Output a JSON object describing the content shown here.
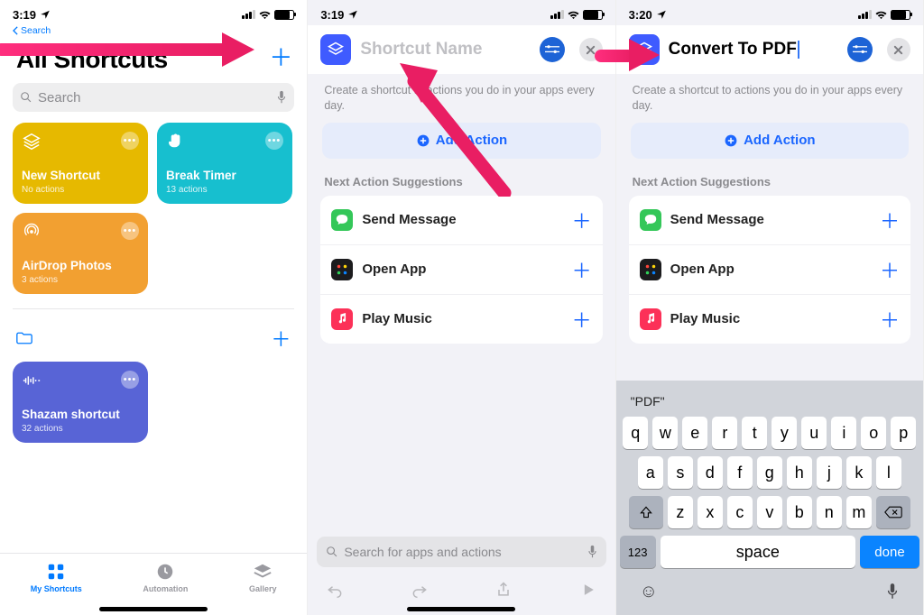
{
  "status": {
    "time1": "3:19",
    "time2": "3:19",
    "time3": "3:20",
    "back": "Search"
  },
  "p1": {
    "title": "All Shortcuts",
    "search_placeholder": "Search",
    "plus": "＋",
    "cards": [
      {
        "name": "New Shortcut",
        "sub": "No actions",
        "color": "#e6b900"
      },
      {
        "name": "Break Timer",
        "sub": "13 actions",
        "color": "#17bfcf"
      },
      {
        "name": "AirDrop Photos",
        "sub": "3 actions",
        "color": "#f2a031"
      },
      {
        "name": "Shazam shortcut",
        "sub": "32 actions",
        "color": "#5864d6"
      }
    ],
    "tabs": [
      "My Shortcuts",
      "Automation",
      "Gallery"
    ]
  },
  "editor": {
    "placeholder": "Shortcut Name",
    "title3": "Convert To PDF",
    "desc": "Create a shortcut to actions you do in your apps every day.",
    "add_action": "Add Action",
    "sugg_header": "Next Action Suggestions",
    "suggestions": [
      {
        "label": "Send Message",
        "color": "#34c759"
      },
      {
        "label": "Open App",
        "color": "#000",
        "grid": true
      },
      {
        "label": "Play Music",
        "color": "#fc3158"
      }
    ],
    "search_placeholder": "Search for apps and actions"
  },
  "kbd": {
    "sugg": "\"PDF\"",
    "row1": [
      "q",
      "w",
      "e",
      "r",
      "t",
      "y",
      "u",
      "i",
      "o",
      "p"
    ],
    "row2": [
      "a",
      "s",
      "d",
      "f",
      "g",
      "h",
      "j",
      "k",
      "l"
    ],
    "row3": [
      "z",
      "x",
      "c",
      "v",
      "b",
      "n",
      "m"
    ],
    "num": "123",
    "space": "space",
    "done": "done"
  }
}
